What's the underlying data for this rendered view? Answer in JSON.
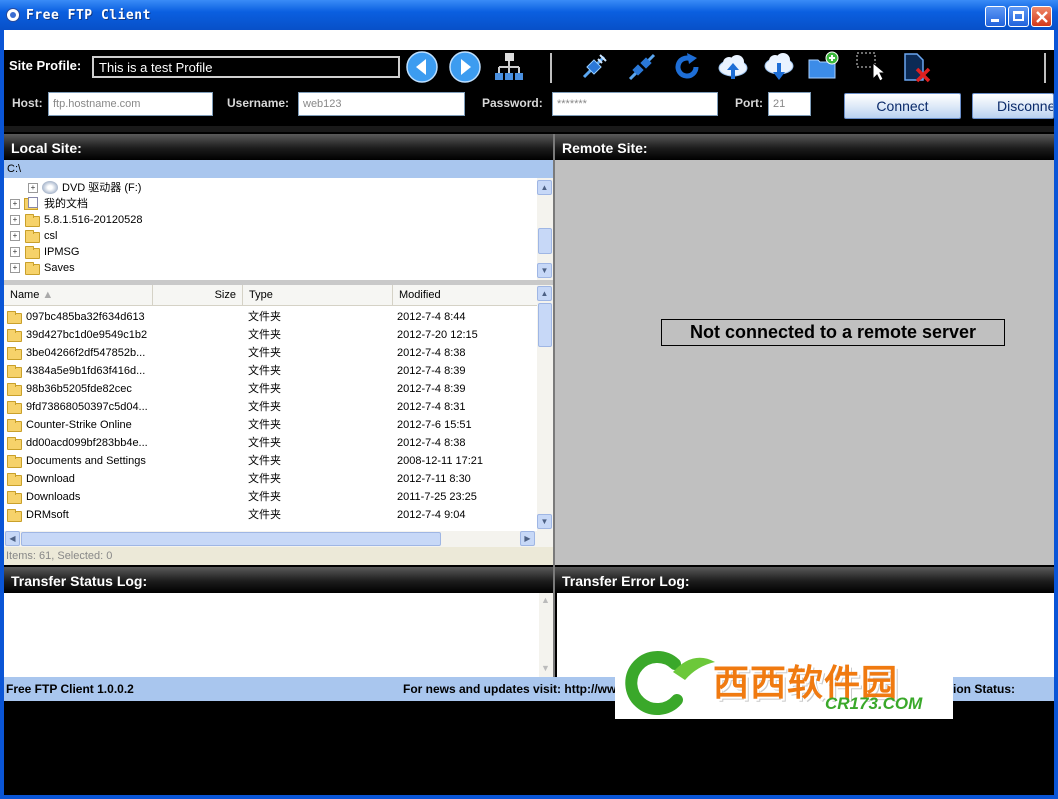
{
  "window": {
    "title": "Free FTP Client"
  },
  "toolbar": {
    "site_profile_label": "Site Profile:",
    "site_profile_value": "This is a test Profile",
    "icons": [
      "back-arrow-icon",
      "forward-arrow-icon",
      "network-icon",
      "connect-plug-icon",
      "disconnect-plug-icon",
      "refresh-icon",
      "upload-cloud-icon",
      "download-cloud-icon",
      "new-folder-icon",
      "select-cursor-icon",
      "delete-file-icon"
    ]
  },
  "connection": {
    "host_label": "Host:",
    "host_placeholder": "ftp.hostname.com",
    "username_label": "Username:",
    "username_placeholder": "web123",
    "password_label": "Password:",
    "password_placeholder": "*******",
    "port_label": "Port:",
    "port_placeholder": "21",
    "connect_label": "Connect",
    "disconnect_label": "Disconne"
  },
  "local": {
    "header": "Local Site:",
    "path": "C:\\",
    "tree": [
      {
        "label": "DVD 驱动器 (F:)",
        "indent": 2,
        "icon": "dvd-drive-icon"
      },
      {
        "label": "我的文档",
        "indent": 1,
        "icon": "documents-folder-icon"
      },
      {
        "label": "5.8.1.516-20120528",
        "indent": 1,
        "icon": "folder-icon"
      },
      {
        "label": "csl",
        "indent": 1,
        "icon": "folder-icon"
      },
      {
        "label": "IPMSG",
        "indent": 1,
        "icon": "folder-icon"
      },
      {
        "label": "Saves",
        "indent": 1,
        "icon": "folder-icon"
      }
    ],
    "columns": {
      "name": "Name",
      "size": "Size",
      "type": "Type",
      "modified": "Modified"
    },
    "files": [
      {
        "name": "097bc485ba32f634d613",
        "type": "文件夹",
        "modified": "2012-7-4 8:44"
      },
      {
        "name": "39d427bc1d0e9549c1b2",
        "type": "文件夹",
        "modified": "2012-7-20 12:15"
      },
      {
        "name": "3be04266f2df547852b...",
        "type": "文件夹",
        "modified": "2012-7-4 8:38"
      },
      {
        "name": "4384a5e9b1fd63f416d...",
        "type": "文件夹",
        "modified": "2012-7-4 8:39"
      },
      {
        "name": "98b36b5205fde82cec",
        "type": "文件夹",
        "modified": "2012-7-4 8:39"
      },
      {
        "name": "9fd73868050397c5d04...",
        "type": "文件夹",
        "modified": "2012-7-4 8:31"
      },
      {
        "name": "Counter-Strike Online",
        "type": "文件夹",
        "modified": "2012-7-6 15:51"
      },
      {
        "name": "dd00acd099bf283bb4e...",
        "type": "文件夹",
        "modified": "2012-7-4 8:38"
      },
      {
        "name": "Documents and Settings",
        "type": "文件夹",
        "modified": "2008-12-11 17:21"
      },
      {
        "name": "Download",
        "type": "文件夹",
        "modified": "2012-7-11 8:30"
      },
      {
        "name": "Downloads",
        "type": "文件夹",
        "modified": "2011-7-25 23:25"
      },
      {
        "name": "DRMsoft",
        "type": "文件夹",
        "modified": "2012-7-4 9:04"
      }
    ],
    "status": "Items: 61, Selected: 0"
  },
  "remote": {
    "header": "Remote Site:",
    "message": "Not connected to a remote server"
  },
  "logs": {
    "status_header": "Transfer Status Log:",
    "error_header": "Transfer Error Log:"
  },
  "footer": {
    "version": "Free FTP Client  1.0.0.2",
    "news": "For news and updates visit: http://ww",
    "connection_status": "ion Status:"
  },
  "watermark": {
    "text_cn": "西西软件园",
    "text_en": "CR173.COM",
    "colors": {
      "green": "#3aa82a",
      "orange": "#f07a10"
    }
  }
}
